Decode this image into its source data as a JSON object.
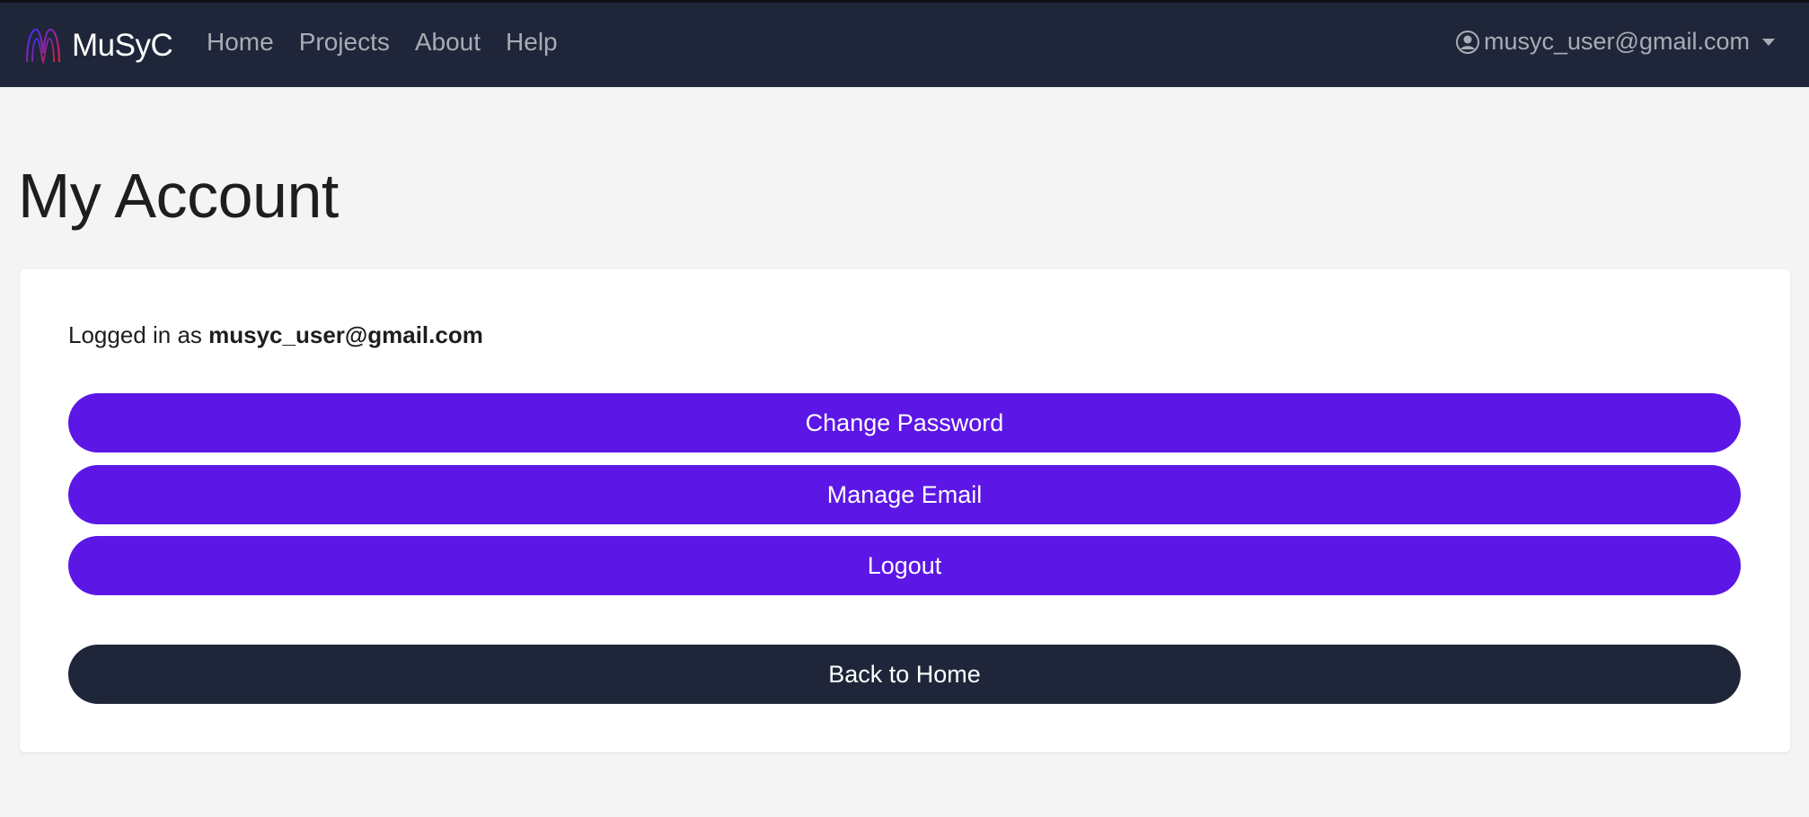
{
  "navbar": {
    "brand": "MuSyC",
    "links": [
      {
        "label": "Home"
      },
      {
        "label": "Projects"
      },
      {
        "label": "About"
      },
      {
        "label": "Help"
      }
    ],
    "user_email": "musyc_user@gmail.com"
  },
  "page": {
    "title": "My Account"
  },
  "account": {
    "logged_in_prefix": "Logged in as ",
    "logged_in_email": "musyc_user@gmail.com",
    "buttons": {
      "change_password": "Change Password",
      "manage_email": "Manage Email",
      "logout": "Logout",
      "back_home": "Back to Home"
    }
  },
  "colors": {
    "navbar": "#1f2639",
    "primary": "#5c17e6",
    "dark_button": "#1f2639",
    "background": "#f4f4f4"
  },
  "icons": {
    "brand": "musyc-logo-icon",
    "user": "user-circle-icon",
    "dropdown": "caret-down-icon"
  }
}
